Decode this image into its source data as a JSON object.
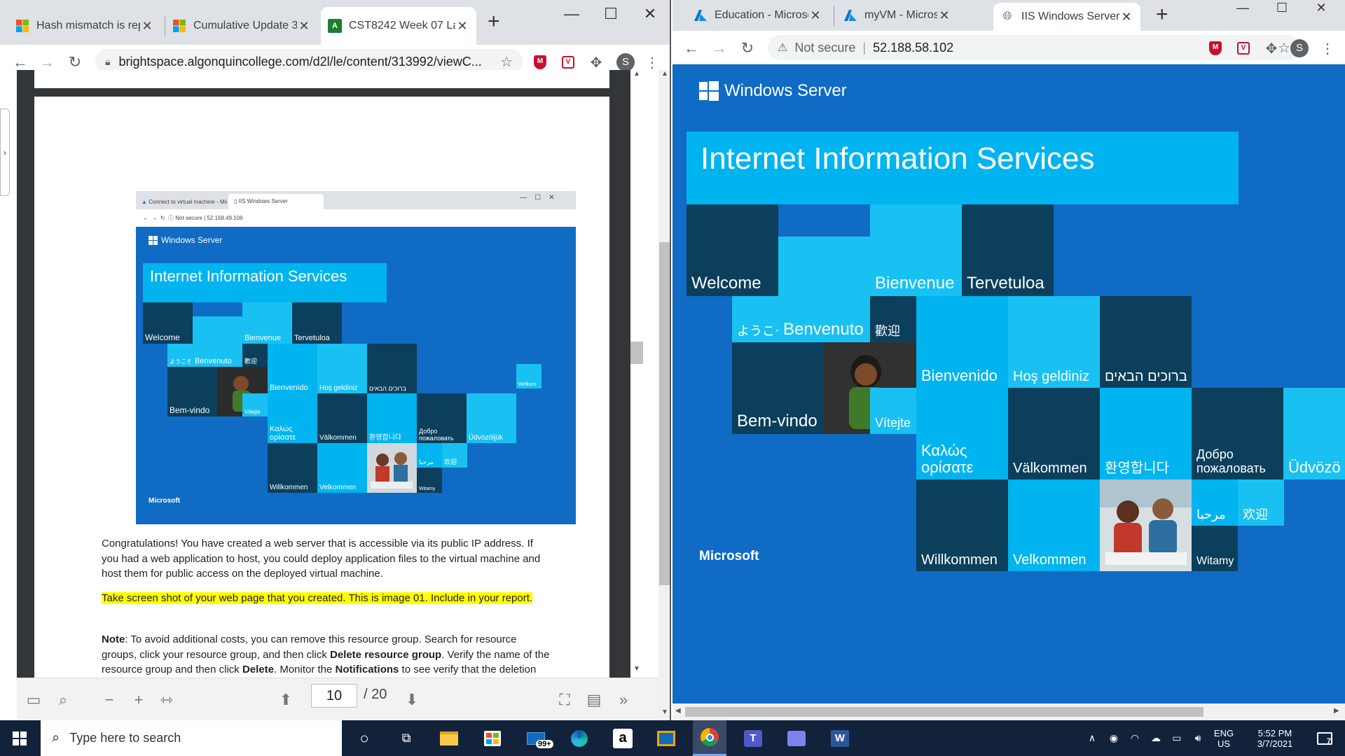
{
  "left_window": {
    "tabs": [
      {
        "title": "Hash mismatch is rep",
        "favicon": "windows-logo-icon"
      },
      {
        "title": "Cumulative Update 3",
        "favicon": "windows-logo-icon"
      },
      {
        "title": "CST8242 Week 07 La",
        "favicon": "acrobat-icon"
      }
    ],
    "url": "brightspace.algonquincollege.com/d2l/le/content/313992/viewC...",
    "avatar": "S",
    "pdf": {
      "current_page": "10",
      "total_pages": "/ 20",
      "para1": "Congratulations! You have created a web server that is accessible via its public IP address. If you had a web application to host, you could deploy application files to the virtual machine and host them for public access on the deployed virtual machine.",
      "para2": "Take screen shot of your web page that you created.  This is image 01.  Include in your report.",
      "note_label": "Note",
      "note_a": ": To avoid additional costs, you can remove this resource group. Search for resource groups, click your resource group, and then click ",
      "note_b": "Delete resource group",
      "note_c": ". Verify the name of the resource group and then click ",
      "note_d": "Delete",
      "note_e": ". Monitor the ",
      "note_f": "Notifications",
      "note_g": " to see verify that the deletion completed successfully.",
      "shot": {
        "tab1": "Connect to virtual machine - Mic",
        "tab2": "IIS Windows Server",
        "not_secure": "Not secure",
        "url": "52.168.49.106",
        "brand": "Windows Server",
        "banner": "Internet Information Services",
        "footer": "Microsoft",
        "words": {
          "welcome": "Welcome",
          "bienvenue": "Bienvenue",
          "tervetuloa": "Tervetuloa",
          "youkoso": "ようこそ",
          "benvenuto": "Benvenuto",
          "kangei": "歡迎",
          "bienvenido": "Bienvenido",
          "hos": "Hoş geldiniz",
          "hebrew": "ברוכים הבאים",
          "welkom": "Welkom",
          "bemvindo": "Bem-vindo",
          "vitejte": "Vítejte",
          "kalos": "Καλώς ορίσατε",
          "valkommen": "Välkommen",
          "korean": "환영합니다",
          "dobro": "Добро пожаловать",
          "udvozoljuk": "Üdvözöljük",
          "arabic": "مرحبا",
          "huanying": "欢迎",
          "willkommen": "Willkommen",
          "velkommen": "Velkommen",
          "witamy": "Witamy"
        }
      }
    }
  },
  "right_window": {
    "tabs": [
      {
        "title": "Education - Microsoft",
        "favicon": "azure-icon"
      },
      {
        "title": "myVM - Microsoft Az",
        "favicon": "azure-icon"
      },
      {
        "title": "IIS Windows Server",
        "favicon": "globe-icon"
      }
    ],
    "not_secure": "Not secure",
    "url": "52.188.58.102",
    "avatar": "S",
    "iis": {
      "brand": "Windows Server",
      "banner": "Internet Information Services",
      "footer": "Microsoft",
      "words": {
        "welcome": "Welcome",
        "bienvenue": "Bienvenue",
        "tervetuloa": "Tervetuloa",
        "youkoso": "ようこそ",
        "benvenuto": "Benvenuto",
        "kangei": "歡迎",
        "bienvenido": "Bienvenido",
        "hos": "Hoş geldiniz",
        "hebrew": "ברוכים הבאים",
        "bemvindo": "Bem-vindo",
        "vitejte": "Vítejte",
        "kalos": "Καλώς ορίσατε",
        "valkommen": "Välkommen",
        "korean": "환영합니다",
        "dobro": "Добро пожаловать",
        "udvozo": "Üdvözö",
        "arabic": "مرحبا",
        "huanying": "欢迎",
        "willkommen": "Willkommen",
        "velkommen": "Velkommen",
        "witamy": "Witamy"
      }
    }
  },
  "taskbar": {
    "search_placeholder": "Type here to search",
    "mail_badge": "99+",
    "lang": "ENG",
    "region": "US",
    "time": "5:52 PM",
    "date": "3/7/2021",
    "notification_count": "7"
  },
  "colors": {
    "iis_blue": "#0f6bc4",
    "iis_cyan": "#00b4ef",
    "iis_light_cyan": "#19c1f2",
    "iis_dark_teal": "#0b3f5c",
    "taskbar": "#13223b",
    "highlight": "#ffff00"
  }
}
